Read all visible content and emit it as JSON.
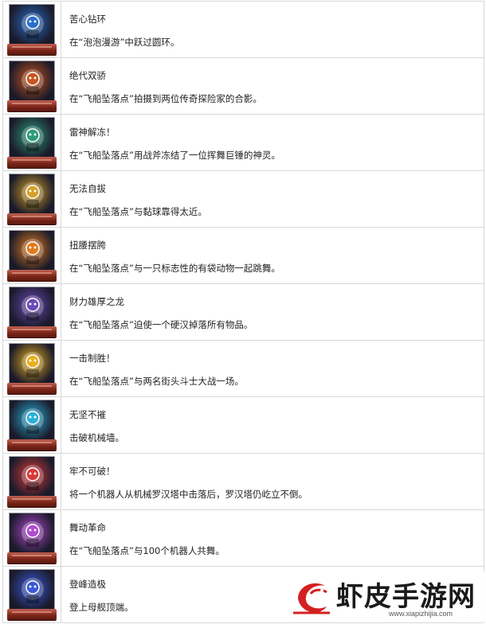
{
  "trophies": [
    {
      "title": "苦心钻环",
      "desc": "在“泡泡漫游”中跃过圆环。",
      "icon": "penguin-trophy-icon",
      "color": "#2a6fc9"
    },
    {
      "title": "绝代双骄",
      "desc": "在“飞船坠落点”拍摄到两位传奇探险家的合影。",
      "icon": "duo-silhouette-trophy-icon",
      "color": "#c9551e"
    },
    {
      "title": "雷神解冻！",
      "desc": "在“飞船坠落点”用战斧冻结了一位挥舞巨锤的神灵。",
      "icon": "frozen-god-trophy-icon",
      "color": "#2f9a7a"
    },
    {
      "title": "无法自拔",
      "desc": "在“飞船坠落点”与黏球靠得太近。",
      "icon": "sticky-ball-trophy-icon",
      "color": "#d4a12a"
    },
    {
      "title": "扭腰摆胯",
      "desc": "在“飞船坠落点”与一只标志性的有袋动物一起跳舞。",
      "icon": "dancing-robot-trophy-icon",
      "color": "#e07b1f"
    },
    {
      "title": "财力雄厚之龙",
      "desc": "在“飞船坠落点”迫使一个硬汉掉落所有物品。",
      "icon": "dragon-trophy-icon",
      "color": "#6b4ab5"
    },
    {
      "title": "一击制胜！",
      "desc": "在“飞船坠落点”与两名街头斗士大战一场。",
      "icon": "ko-trophy-icon",
      "color": "#e8b020"
    },
    {
      "title": "无坚不摧",
      "desc": "击破机械墙。",
      "icon": "robot-spotlight-trophy-icon",
      "color": "#2bb0d8"
    },
    {
      "title": "牢不可破！",
      "desc": "将一个机器人从机械罗汉塔中击落后，罗汉塔仍屹立不倒。",
      "icon": "robot-tower-trophy-icon",
      "color": "#d83a3a"
    },
    {
      "title": "舞动革命",
      "desc": "在“飞船坠落点”与100个机器人共舞。",
      "icon": "robot-crowd-trophy-icon",
      "color": "#b04ad0"
    },
    {
      "title": "登峰造极",
      "desc": "登上母舰顶端。",
      "icon": "mothership-trophy-icon",
      "color": "#3a5ad8"
    }
  ],
  "watermark": {
    "text": "虾皮手游网",
    "url": "www.xiapizhijia.com",
    "accent": "#d42020"
  }
}
